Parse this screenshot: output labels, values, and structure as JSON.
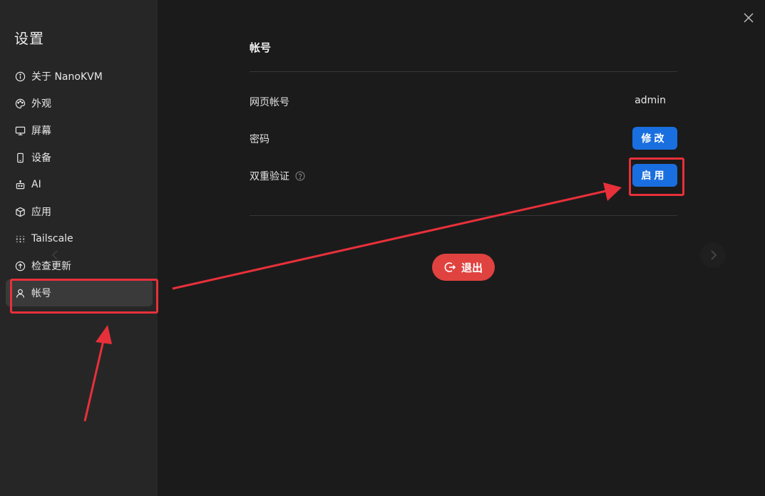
{
  "sidebar": {
    "title": "设置",
    "items": [
      {
        "label": "关于 NanoKVM",
        "icon": "info-icon"
      },
      {
        "label": "外观",
        "icon": "palette-icon"
      },
      {
        "label": "屏幕",
        "icon": "monitor-icon"
      },
      {
        "label": "设备",
        "icon": "smartphone-icon"
      },
      {
        "label": "AI",
        "icon": "robot-icon"
      },
      {
        "label": "应用",
        "icon": "package-icon"
      },
      {
        "label": "Tailscale",
        "icon": "tailscale-icon"
      },
      {
        "label": "检查更新",
        "icon": "arrow-up-circle-icon"
      },
      {
        "label": "帐号",
        "icon": "user-icon",
        "active": true
      }
    ]
  },
  "account": {
    "title": "帐号",
    "web_account_label": "网页帐号",
    "web_account_value": "admin",
    "password_label": "密码",
    "password_button": "修改",
    "two_factor_label": "双重验证",
    "two_factor_button": "启用",
    "logout_button": "退出"
  },
  "colors": {
    "primary_button": "#1a6fe0",
    "logout_button": "#e0423f",
    "annotation": "#e8303a"
  }
}
